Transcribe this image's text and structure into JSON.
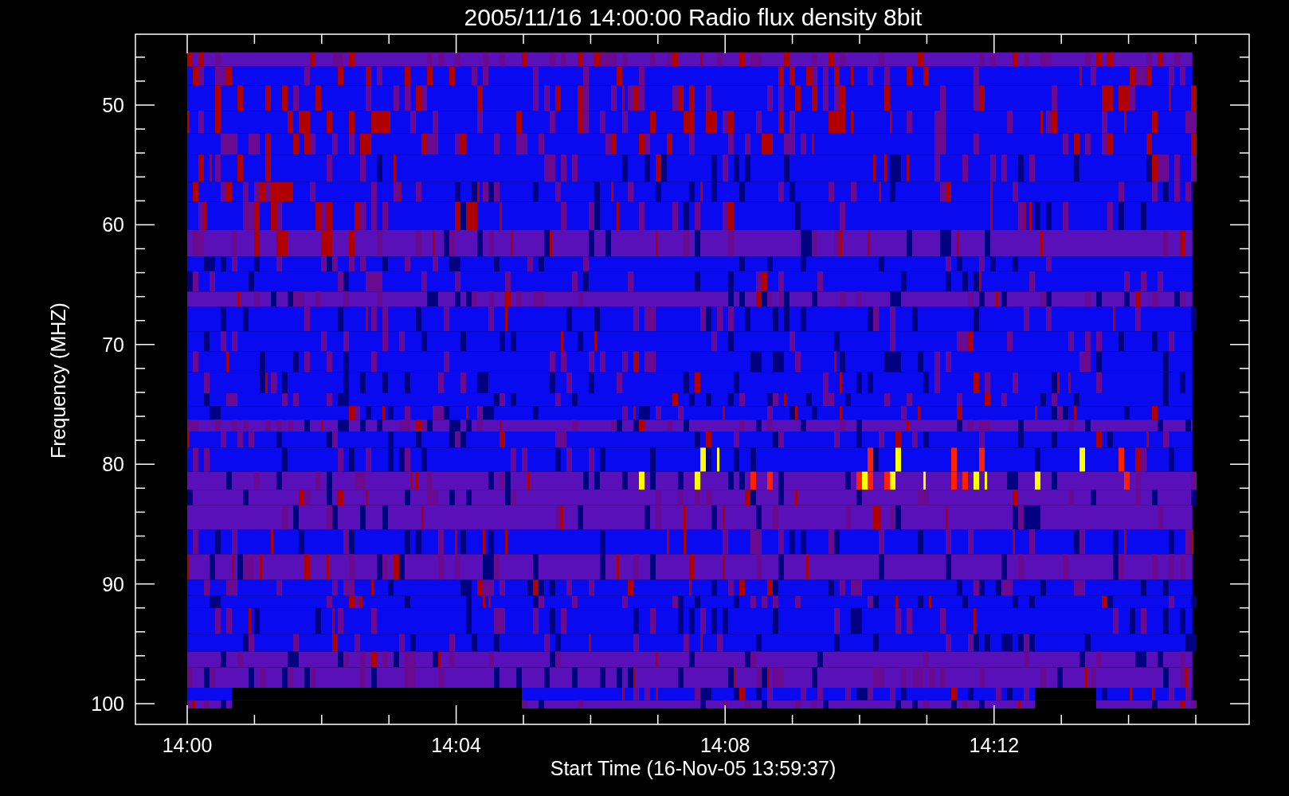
{
  "title": "2005/11/16 14:00:00 Radio flux density 8bit",
  "y_axis": {
    "label": "Frequency (MHZ)",
    "ticks": [
      "50",
      "60",
      "70",
      "80",
      "90",
      "100"
    ]
  },
  "x_axis": {
    "label": "Start Time (16-Nov-05 13:59:37)",
    "ticks": [
      "14:00",
      "14:04",
      "14:08",
      "14:12"
    ]
  }
}
